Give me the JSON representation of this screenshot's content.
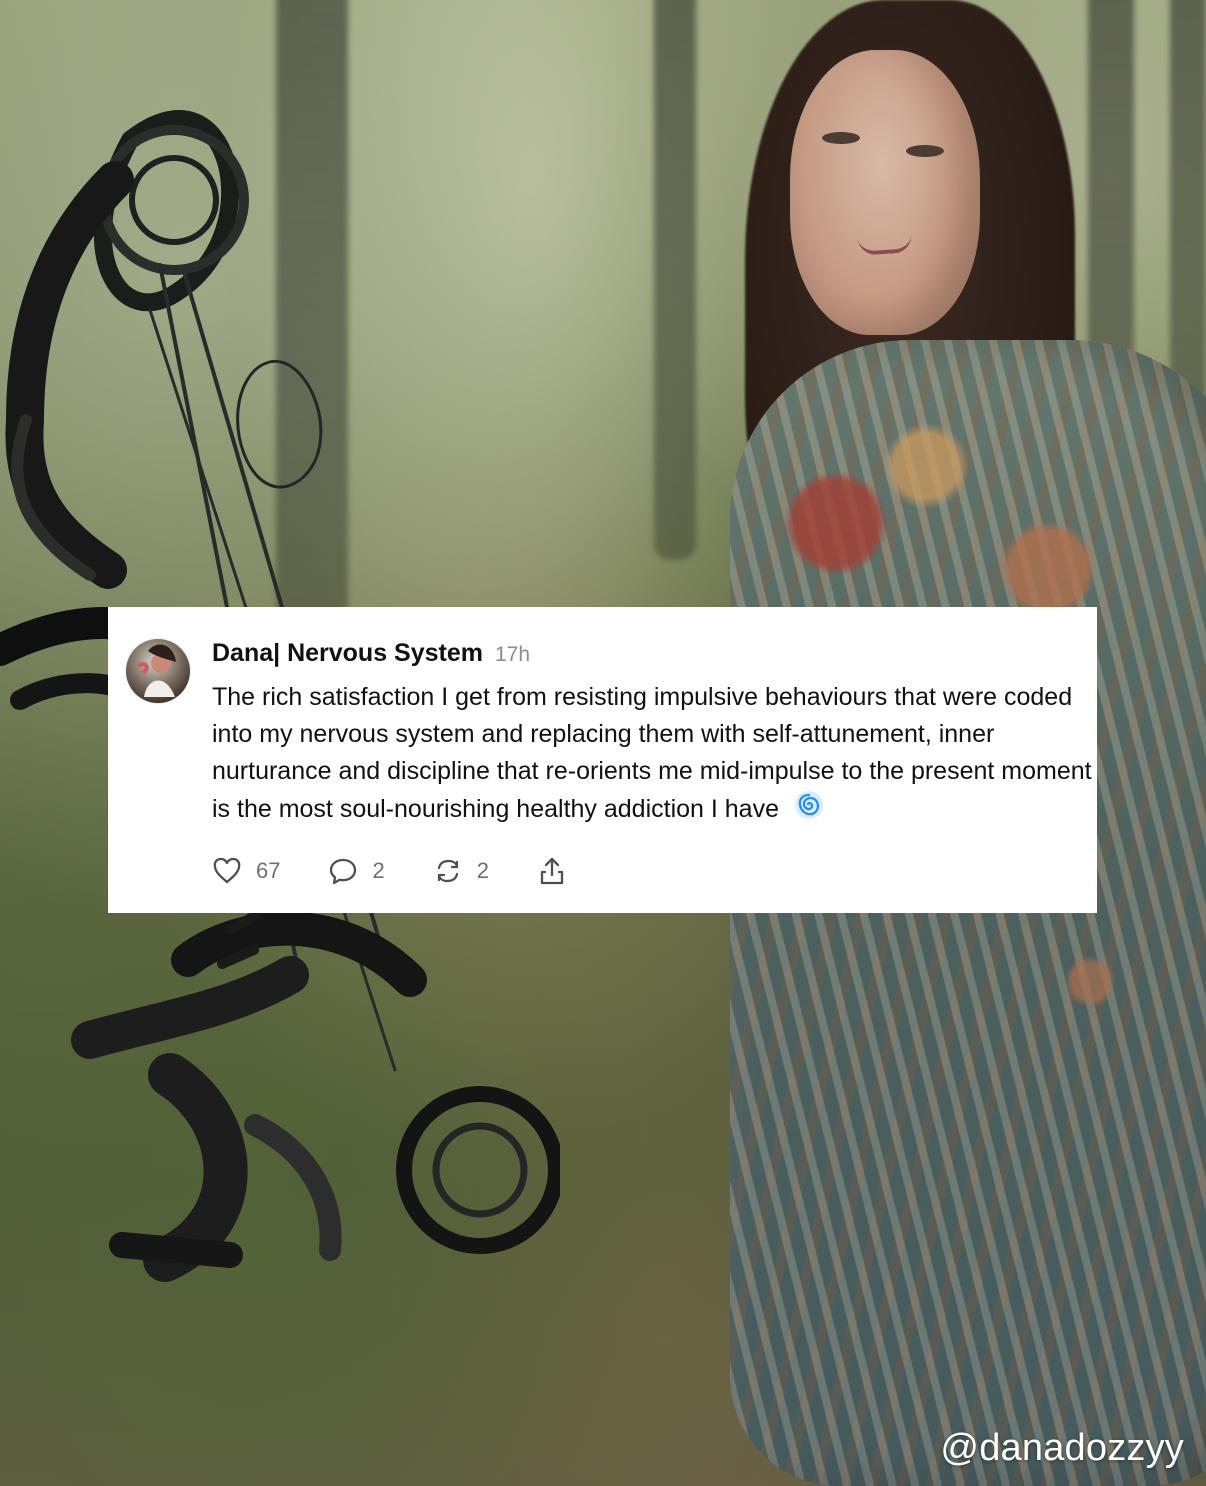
{
  "post": {
    "author": "Dana| Nervous System",
    "time": "17h",
    "text": "The rich satisfaction I get from resisting impulsive behaviours that were coded into my nervous system and replacing them with self-attunement, inner nurturance and discipline that re-orients me mid-impulse to the present moment is the most soul-nourishing healthy addiction I have",
    "likes": "67",
    "replies": "2",
    "reposts": "2"
  },
  "watermark": "@danadozzyy",
  "icons": {
    "avatar": "avatar-photo",
    "emoji": "swirl-icon",
    "like": "heart-icon",
    "reply": "comment-icon",
    "repost": "repost-icon",
    "share": "share-icon"
  },
  "colors": {
    "card_background": "#ffffff",
    "text_primary": "#111111",
    "text_secondary": "#8b8b8b",
    "icon_gray": "#6f6f6f",
    "watermark": "#ffffff"
  }
}
